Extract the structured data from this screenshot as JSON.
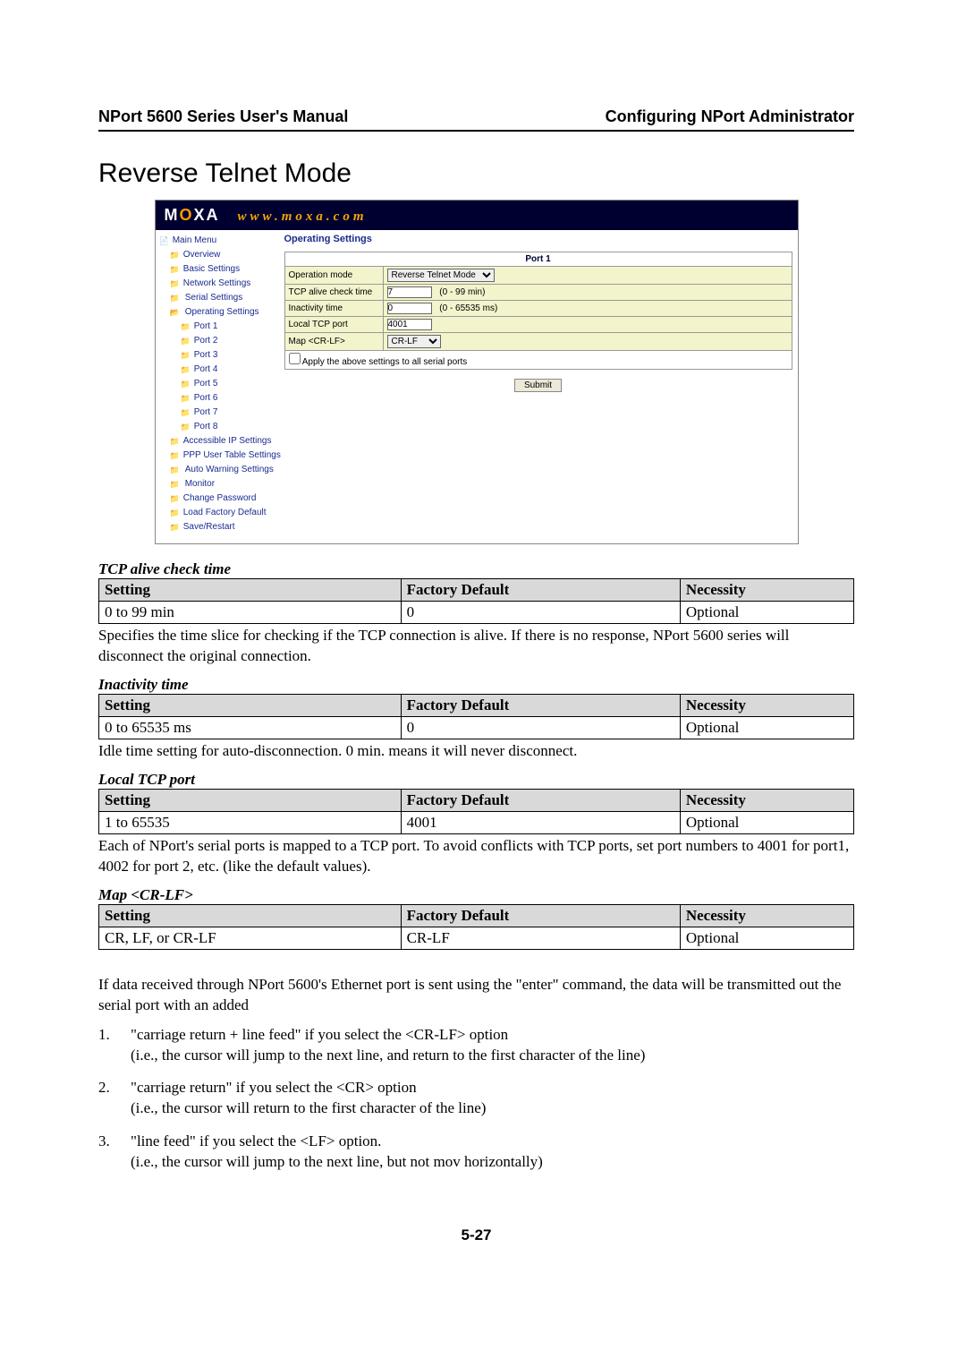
{
  "header": {
    "left": "NPort 5600 Series User's Manual",
    "right": "Configuring NPort Administrator"
  },
  "section_title": "Reverse Telnet Mode",
  "panel": {
    "logo_left": "M",
    "logo_dot": "O",
    "logo_right": "XA",
    "url": "www.moxa.com",
    "heading": "Operating Settings",
    "nav": {
      "main": "Main Menu",
      "overview": "Overview",
      "basic": "Basic Settings",
      "network": "Network Settings",
      "serial": "Serial Settings",
      "operating": "Operating Settings",
      "ports": [
        "Port 1",
        "Port 2",
        "Port 3",
        "Port 4",
        "Port 5",
        "Port 6",
        "Port 7",
        "Port 8"
      ],
      "accessible": "Accessible IP Settings",
      "ppp": "PPP User Table Settings",
      "autowarn": "Auto Warning Settings",
      "monitor": "Monitor",
      "changepw": "Change Password",
      "loadfactory": "Load Factory Default",
      "saverestart": "Save/Restart"
    },
    "config": {
      "port_header": "Port 1",
      "operation_mode_label": "Operation mode",
      "operation_mode_value": "Reverse Telnet Mode",
      "tcp_alive_label": "TCP alive check time",
      "tcp_alive_value": "7",
      "tcp_alive_hint": "(0 - 99 min)",
      "inactivity_label": "Inactivity time",
      "inactivity_value": "0",
      "inactivity_hint": "(0 - 65535 ms)",
      "local_tcp_label": "Local TCP port",
      "local_tcp_value": "4001",
      "map_label": "Map <CR-LF>",
      "map_value": "CR-LF",
      "apply_label": "Apply the above settings to all serial ports",
      "submit": "Submit"
    }
  },
  "tables": {
    "headers": {
      "setting": "Setting",
      "default": "Factory Default",
      "necessity": "Necessity"
    },
    "tcp_alive": {
      "title": "TCP alive check time",
      "setting": "0 to 99 min",
      "default": "0",
      "necessity": "Optional",
      "note": "Specifies the time slice for checking if the TCP connection is alive. If there is no response, NPort 5600 series will disconnect the original connection."
    },
    "inactivity": {
      "title": "Inactivity time",
      "setting": "0 to 65535 ms",
      "default": "0",
      "necessity": "Optional",
      "note": "Idle time setting for auto-disconnection. 0 min. means it will never disconnect."
    },
    "local_tcp": {
      "title": "Local TCP port",
      "setting": "1 to 65535",
      "default": "4001",
      "necessity": "Optional",
      "note": "Each of NPort's serial ports is mapped to a TCP port. To avoid conflicts with TCP ports, set port numbers to 4001 for port1, 4002 for port 2, etc. (like the default values)."
    },
    "map_crlf": {
      "title": "Map <CR-LF>",
      "setting": "CR, LF, or CR-LF",
      "default": "CR-LF",
      "necessity": "Optional"
    }
  },
  "paragraph_intro": "If data received through NPort 5600's Ethernet port is sent using the \"enter\" command, the data will be transmitted out the serial port with an added",
  "list": [
    {
      "lead": "\"carriage return + line feed\" if you select the <CR-LF> option",
      "sub": "(i.e., the cursor will jump to the next line, and return to the first character of the line)"
    },
    {
      "lead": "\"carriage return\" if you select the <CR> option",
      "sub": "(i.e., the cursor will return to the first character of the line)"
    },
    {
      "lead": "\"line feed\" if you select the <LF> option.",
      "sub": "(i.e., the cursor will jump to the next line, but not mov horizontally)"
    }
  ],
  "page_num": "5-27"
}
